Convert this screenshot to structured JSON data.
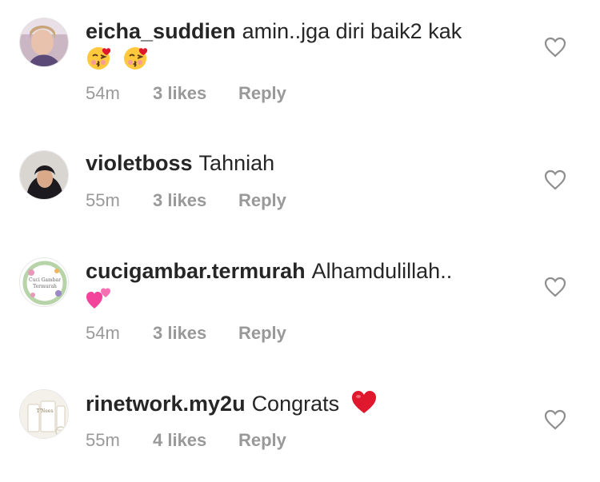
{
  "comments": [
    {
      "username": "eicha_suddien",
      "text": "amin..jga diri baik2 kak",
      "emoji": [
        "kiss-face",
        "kiss-face"
      ],
      "time": "54m",
      "likes": "3 likes",
      "reply": "Reply"
    },
    {
      "username": "violetboss",
      "text": "Tahniah",
      "emoji": [],
      "time": "55m",
      "likes": "3 likes",
      "reply": "Reply"
    },
    {
      "username": "cucigambar.termurah",
      "text": "Alhamdulillah..",
      "emoji": [
        "two-hearts"
      ],
      "avatar_text": [
        "Cuci Gambar",
        "Termurah"
      ],
      "time": "54m",
      "likes": "3 likes",
      "reply": "Reply"
    },
    {
      "username": "rinetwork.my2u",
      "text": "Congrats",
      "emoji": [
        "red-heart"
      ],
      "avatar_text": "T'Nees",
      "time": "55m",
      "likes": "4 likes",
      "reply": "Reply"
    }
  ],
  "colors": {
    "text": "#262626",
    "meta": "#999999",
    "heart_outline": "#8e8e8e",
    "red_heart": "#e0182d"
  },
  "icons": [
    "heart-outline-icon"
  ]
}
